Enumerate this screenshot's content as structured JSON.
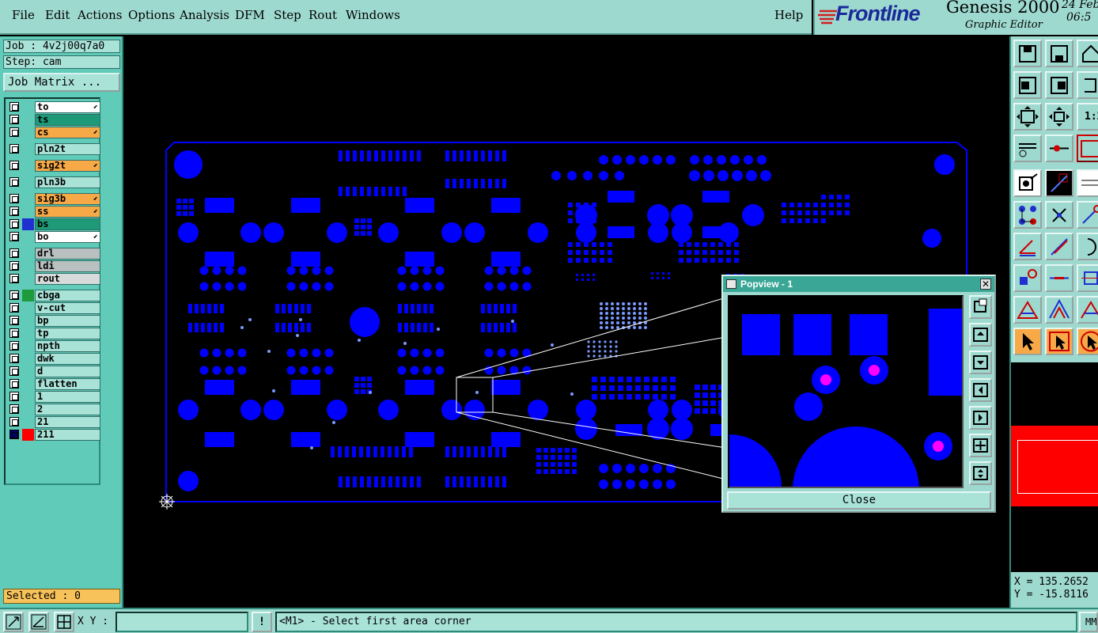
{
  "menu": {
    "items": [
      "File",
      "Edit",
      "Actions",
      "Options",
      "Analysis",
      "DFM",
      "Step",
      "Rout",
      "Windows"
    ],
    "help": "Help"
  },
  "brand": {
    "logo": "Frontline",
    "product": "Genesis 2000",
    "subtitle": "Graphic Editor",
    "date": "24 Feb",
    "time": "06:5"
  },
  "job": {
    "job_label": "Job : 4v2j00q7a0",
    "step_label": "Step: cam",
    "matrix_button": "Job Matrix ..."
  },
  "layers": [
    {
      "name": "to",
      "bg": "#ffffff",
      "arrow": true
    },
    {
      "name": "ts",
      "bg": "#1f9a78",
      "arrow": false
    },
    {
      "name": "cs",
      "bg": "#f7a948",
      "arrow": true
    },
    {
      "name": "pln2t",
      "bg": "#a9e3d8",
      "arrow": false
    },
    {
      "name": "sig2t",
      "bg": "#f7a948",
      "arrow": true
    },
    {
      "name": "pln3b",
      "bg": "#a9e3d8",
      "arrow": false
    },
    {
      "name": "sig3b",
      "bg": "#f7a948",
      "arrow": true
    },
    {
      "name": "ss",
      "bg": "#f7a948",
      "arrow": true
    },
    {
      "name": "bs",
      "bg": "#1f9a78",
      "arrow": false
    },
    {
      "name": "bo",
      "bg": "#ffffff",
      "arrow": true
    },
    {
      "name": "drl",
      "bg": "#b8c0c0",
      "arrow": false
    },
    {
      "name": "ldi",
      "bg": "#b8c0c0",
      "arrow": false
    },
    {
      "name": "rout",
      "bg": "#d6dada",
      "arrow": false
    },
    {
      "name": "cbga",
      "bg": "#a9e3d8",
      "arrow": false
    },
    {
      "name": "v-cut",
      "bg": "#a9e3d8",
      "arrow": false
    },
    {
      "name": "bp",
      "bg": "#a9e3d8",
      "arrow": false
    },
    {
      "name": "tp",
      "bg": "#a9e3d8",
      "arrow": false
    },
    {
      "name": "npth",
      "bg": "#a9e3d8",
      "arrow": false
    },
    {
      "name": "dwk",
      "bg": "#a9e3d8",
      "arrow": false
    },
    {
      "name": "d",
      "bg": "#a9e3d8",
      "arrow": false
    },
    {
      "name": "flatten",
      "bg": "#a9e3d8",
      "arrow": false
    },
    {
      "name": "1",
      "bg": "#a9e3d8",
      "arrow": false
    },
    {
      "name": "2",
      "bg": "#a9e3d8",
      "arrow": false
    },
    {
      "name": "21",
      "bg": "#a9e3d8",
      "arrow": false
    },
    {
      "name": "211",
      "bg": "#a9e3d8",
      "arrow": false
    }
  ],
  "selected": "Selected : 0",
  "popview": {
    "title": "Popview - 1",
    "close_label": "Close"
  },
  "coords": {
    "x": "X = 135.2652",
    "y": "Y = -15.8116"
  },
  "status": {
    "xy_label": "X Y :",
    "xy_value": "",
    "warn": "!",
    "prompt": "<M1> - Select first area corner",
    "units": "MM"
  },
  "colors": {
    "copper": "#0000ff",
    "highlight": "#ff00ff",
    "panel": "#5fcbb8",
    "menu": "#9ed9cf"
  }
}
